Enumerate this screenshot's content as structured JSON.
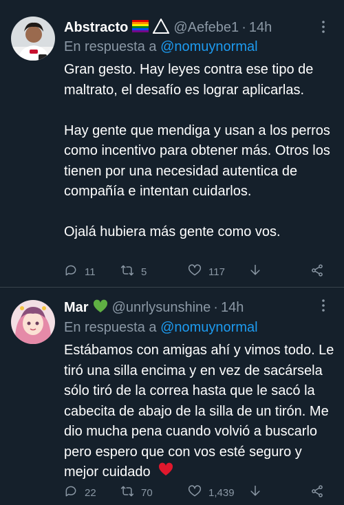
{
  "tweets": [
    {
      "name": "Abstracto",
      "handle": "@Aefebe1",
      "separator": "·",
      "time": "14h",
      "reply_prefix": "En respuesta a",
      "reply_to": "@nomuynormal",
      "paragraphs": [
        "Gran gesto. Hay leyes contra ese tipo de maltrato, el desafío es lograr aplicarlas.",
        "Hay gente que mendiga y usan a los perros como incentivo para obtener más. Otros los tienen por una necesidad autentica de compañía e intentan cuidarlos.",
        "Ojalá hubiera más gente como vos."
      ],
      "replies": "11",
      "retweets": "5",
      "likes": "117"
    },
    {
      "name": "Mar",
      "handle": "@unrlysunshine",
      "separator": "·",
      "time": "14h",
      "reply_prefix": "En respuesta a",
      "reply_to": "@nomuynormal",
      "paragraphs": [
        "Estábamos con amigas ahí y vimos todo. Le tiró una silla encima y en vez de sacársela sólo tiró de la correa hasta que le sacó la cabecita de abajo de la silla de un tirón. Me dio mucha pena cuando volvió a buscarlo pero espero que con vos esté seguro y mejor cuidado"
      ],
      "replies": "22",
      "retweets": "70",
      "likes": "1,439"
    }
  ],
  "colors": {
    "background": "#15202b",
    "secondary_text": "#8b98a5",
    "link": "#1d9bf0",
    "divider": "#38444d"
  },
  "icons": [
    "more-icon",
    "reply-icon",
    "retweet-icon",
    "like-icon",
    "bookmark-icon",
    "share-icon",
    "rainbow-flag-emoji",
    "triangle-emoji",
    "green-heart-emoji",
    "red-heart-emoji"
  ]
}
